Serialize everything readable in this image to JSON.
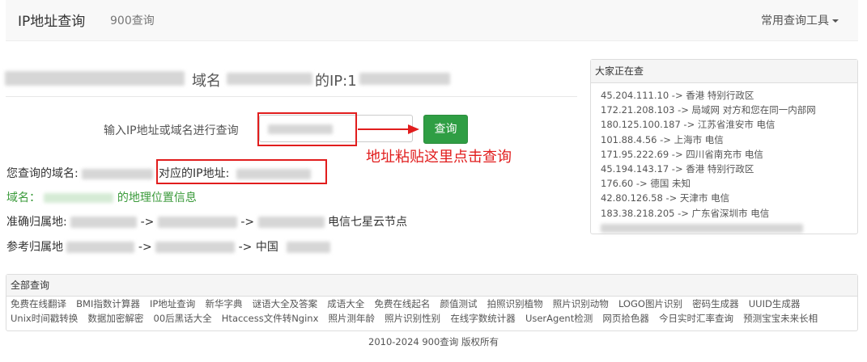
{
  "navbar": {
    "brand": "IP地址查询",
    "sub": "900查询",
    "tools": "常用查询工具"
  },
  "headline": {
    "mid": "域名",
    "ip_label": "的IP:1"
  },
  "query": {
    "label": "输入IP地址或域名进行查询",
    "button": "查询",
    "annotation": "地址粘贴这里点击查询"
  },
  "info": {
    "domain_label": "您查询的域名:",
    "ip_label": "对应的IP地址:",
    "geo_prefix": "域名：",
    "geo_suffix": "的地理位置信息",
    "exact_label": "准确归属地:",
    "exact_tail": "电信七星云节点",
    "arrow": "->",
    "ref_label": "参考归属地",
    "ref_tail": "中国"
  },
  "side": {
    "title": "大家正在查",
    "items": [
      "45.204.111.10 -> 香港 特别行政区",
      "172.21.208.103 -> 局域网 对方和您在同一内部网",
      "180.125.100.187 -> 江苏省淮安市 电信",
      "101.88.4.56 -> 上海市 电信",
      "171.95.222.69 -> 四川省南充市 电信",
      "45.194.143.17 -> 香港 特别行政区",
      "176.60 -> 德国 未知",
      "42.80.126.58 -> 天津市 电信",
      "183.38.218.205 -> 广东省深圳市 电信"
    ]
  },
  "all": {
    "title": "全部查询",
    "row1": [
      "免费在线翻译",
      "BMI指数计算器",
      "IP地址查询",
      "新华字典",
      "谜语大全及答案",
      "成语大全",
      "免费在线起名",
      "颜值测试",
      "拍照识别植物",
      "照片识别动物",
      "LOGO图片识别",
      "密码生成器",
      "UUID生成器"
    ],
    "row2": [
      "Unix时间戳转换",
      "数据加密解密",
      "00后黑话大全",
      "Htaccess文件转Nginx",
      "照片测年龄",
      "照片识别性别",
      "在线字数统计器",
      "UserAgent检测",
      "网页拾色器",
      "今日实时汇率查询",
      "预测宝宝未来长相"
    ]
  },
  "footer": "2010-2024 900查询 版权所有",
  "colors": {
    "accent_green": "#2f9e44",
    "annotation_red": "#e11d1d"
  }
}
